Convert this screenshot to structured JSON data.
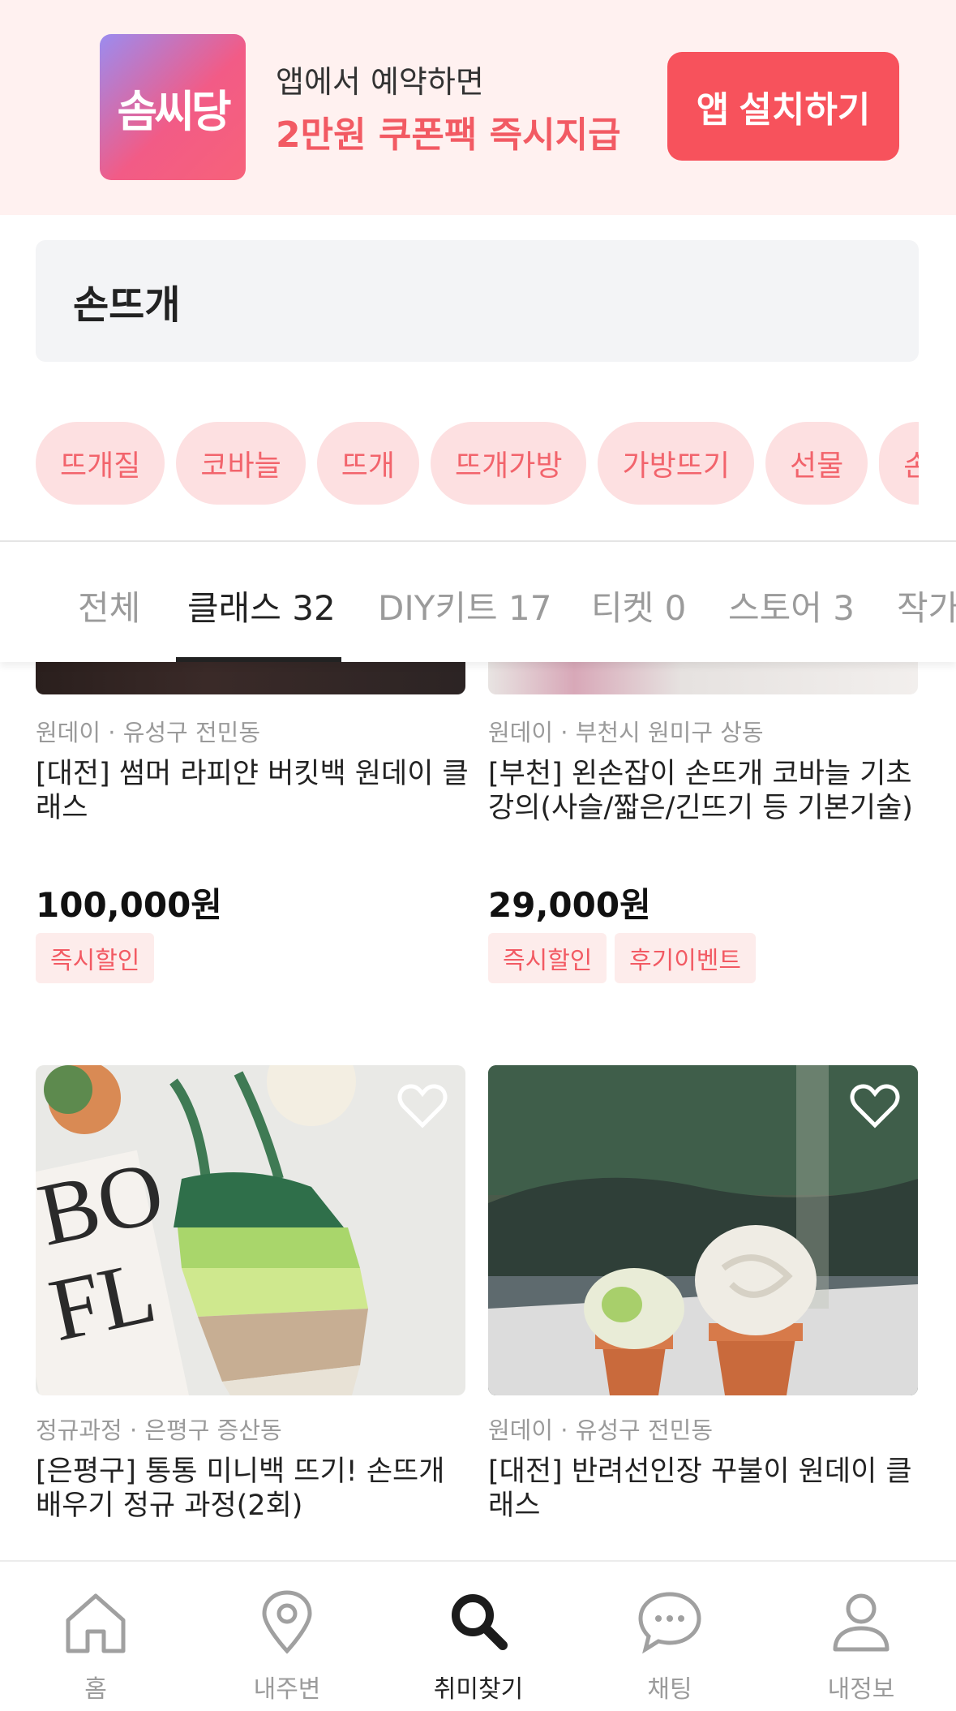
{
  "banner": {
    "logo_text": "솜씨당",
    "line1": "앱에서 예약하면",
    "line2": "2만원 쿠폰팩 즉시지급",
    "install_label": "앱 설치하기"
  },
  "search": {
    "value": "손뜨개"
  },
  "chips": [
    "뜨개질",
    "코바늘",
    "뜨개",
    "뜨개가방",
    "가방뜨기",
    "선물",
    "손"
  ],
  "tabs": [
    {
      "label": "전체"
    },
    {
      "label": "클래스 32"
    },
    {
      "label": "DIY키트 17"
    },
    {
      "label": "티켓 0"
    },
    {
      "label": "스토어 3"
    },
    {
      "label": "작가"
    }
  ],
  "cards": [
    {
      "meta": "원데이 · 유성구 전민동",
      "title": "[대전] 썸머 라피얀 버킷백 원데이 클래스",
      "price": "100,000원",
      "badges": [
        "즉시할인"
      ]
    },
    {
      "meta": "원데이 · 부천시 원미구 상동",
      "title": "[부천] 왼손잡이 손뜨개 코바늘 기초강의(사슬/짧은/긴뜨기 등 기본기술)",
      "price": "29,000원",
      "badges": [
        "즉시할인",
        "후기이벤트"
      ]
    },
    {
      "meta": "정규과정 · 은평구 증산동",
      "title": "[은평구] 통통 미니백 뜨기! 손뜨개 배우기 정규 과정(2회)"
    },
    {
      "meta": "원데이 · 유성구 전민동",
      "title": "[대전] 반려선인장 꾸불이 원데이 클래스"
    }
  ],
  "nav": [
    {
      "label": "홈",
      "icon": "home-icon"
    },
    {
      "label": "내주변",
      "icon": "location-pin-icon"
    },
    {
      "label": "취미찾기",
      "icon": "search-icon"
    },
    {
      "label": "채팅",
      "icon": "chat-bubble-icon"
    },
    {
      "label": "내정보",
      "icon": "profile-icon"
    }
  ],
  "colors": {
    "accent": "#f7525c",
    "chip_bg": "#fde0e1",
    "chip_text": "#f2646c",
    "banner_bg": "#fff1f0"
  }
}
